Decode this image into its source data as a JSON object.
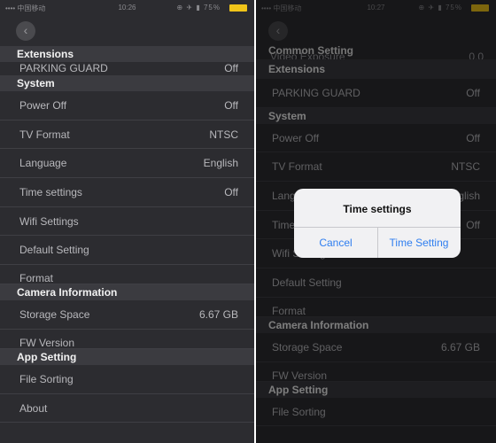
{
  "left_screen": {
    "status": {
      "carrier": "•••• 中国移动",
      "time": "10:26",
      "icons": "⊕ ✈ ▮ 75%"
    },
    "back_icon": "‹",
    "sections": [
      {
        "title": "Extensions",
        "rows": [
          {
            "label": "PARKING GUARD",
            "value": "Off"
          }
        ]
      },
      {
        "title": "System",
        "rows": [
          {
            "label": "Power Off",
            "value": "Off"
          },
          {
            "label": "TV Format",
            "value": "NTSC"
          },
          {
            "label": "Language",
            "value": "English"
          },
          {
            "label": "Time settings",
            "value": "Off"
          },
          {
            "label": "Wifi Settings",
            "value": ""
          },
          {
            "label": "Default Setting",
            "value": ""
          },
          {
            "label": "Format",
            "value": ""
          }
        ]
      },
      {
        "title": "Camera Information",
        "rows": [
          {
            "label": "Storage Space",
            "value": "6.67 GB"
          },
          {
            "label": "FW Version",
            "value": ""
          }
        ]
      },
      {
        "title": "App Setting",
        "rows": [
          {
            "label": "File Sorting",
            "value": ""
          },
          {
            "label": "About",
            "value": ""
          }
        ]
      }
    ]
  },
  "right_screen": {
    "status": {
      "carrier": "•••• 中国移动",
      "time": "10:27",
      "icons": "⊕ ✈ ▮ 75%"
    },
    "back_icon": "‹",
    "cut_row": {
      "label": "Video Exposure",
      "value": "0.0"
    },
    "common_heading": "Common Setting",
    "sections": [
      {
        "title": "Extensions",
        "rows": [
          {
            "label": "PARKING GUARD",
            "value": "Off"
          }
        ]
      },
      {
        "title": "System",
        "rows": [
          {
            "label": "Power Off",
            "value": "Off"
          },
          {
            "label": "TV Format",
            "value": "NTSC"
          },
          {
            "label": "Language",
            "value": "English"
          },
          {
            "label": "Time settings",
            "value": "Off"
          },
          {
            "label": "Wifi Settings",
            "value": ""
          },
          {
            "label": "Default Setting",
            "value": ""
          },
          {
            "label": "Format",
            "value": ""
          }
        ]
      },
      {
        "title": "Camera Information",
        "rows": [
          {
            "label": "Storage Space",
            "value": "6.67 GB"
          },
          {
            "label": "FW Version",
            "value": ""
          }
        ]
      },
      {
        "title": "App Setting",
        "rows": [
          {
            "label": "File Sorting",
            "value": ""
          }
        ]
      }
    ],
    "dialog": {
      "title": "Time settings",
      "cancel": "Cancel",
      "confirm": "Time Setting"
    }
  }
}
